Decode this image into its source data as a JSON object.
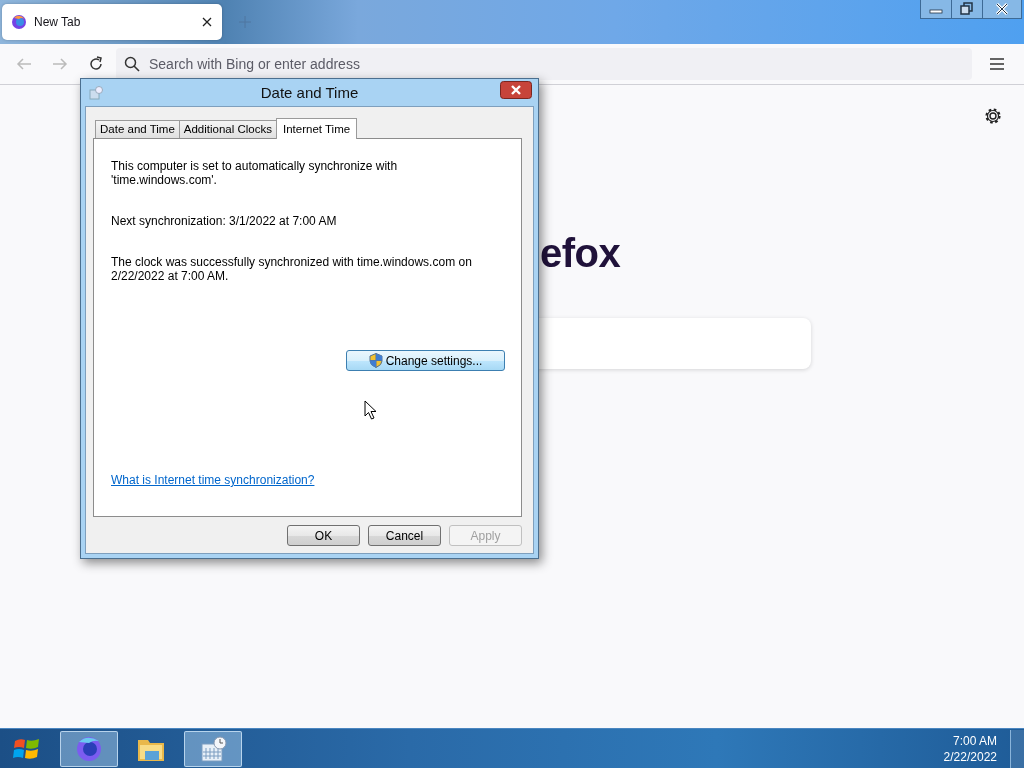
{
  "browser": {
    "tabs": [
      {
        "title": "New Tab",
        "selected": true
      }
    ],
    "address_bar": {
      "placeholder": "Search with Bing or enter address"
    },
    "page": {
      "logo_text": "efox"
    }
  },
  "dialog": {
    "title": "Date and Time",
    "tabs": [
      {
        "label": "Date and Time",
        "selected": false
      },
      {
        "label": "Additional Clocks",
        "selected": false
      },
      {
        "label": "Internet Time",
        "selected": true
      }
    ],
    "paragraphs": [
      "This computer is set to automatically synchronize with 'time.windows.com'.",
      "Next synchronization: 3/1/2022 at 7:00 AM",
      "The clock was successfully synchronized with time.windows.com on 2/22/2022 at 7:00 AM."
    ],
    "change_button": "Change settings...",
    "link": "What is Internet time synchronization?",
    "buttons": [
      {
        "label": "OK",
        "disabled": false
      },
      {
        "label": "Cancel",
        "disabled": false
      },
      {
        "label": "Apply",
        "disabled": true
      }
    ]
  },
  "taskbar": {
    "apps": [
      {
        "kind": "browser",
        "running": true
      },
      {
        "kind": "folder",
        "running": false
      },
      {
        "kind": "calendar",
        "running": true
      }
    ],
    "clock": {
      "time": "7:00 AM",
      "date": "2/22/2022"
    }
  }
}
